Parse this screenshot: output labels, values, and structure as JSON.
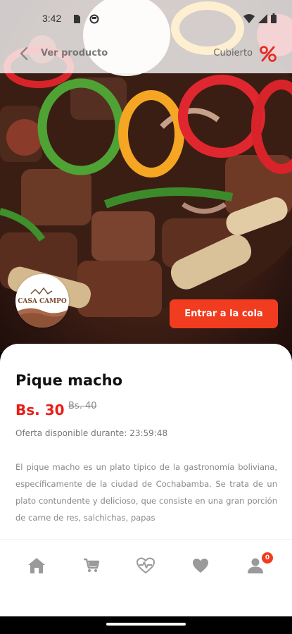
{
  "status_bar": {
    "time": "3:42",
    "icons": [
      "sim-icon",
      "circle-icon",
      "wifi-icon",
      "signal-icon",
      "battery-icon"
    ]
  },
  "app_bar": {
    "title": "Ver producto",
    "cover_label": "Cubierto",
    "back_icon": "chevron-left-icon",
    "discount_icon": "percent-icon"
  },
  "restaurant": {
    "logo_text": "CASA CAMPO"
  },
  "cta": {
    "label": "Entrar a la cola"
  },
  "product": {
    "name": "Pique macho",
    "price": "Bs. 30",
    "old_price": "Bs. 40",
    "offer_label": "Oferta disponible durante:",
    "offer_time": "23:59:48",
    "description": "El pique macho es un plato típico de la gastronomía boliviana, específicamente de la ciudad de Cochabamba. Se trata de un plato contundente y delicioso, que consiste en una gran porción de carne de res, salchichas, papas"
  },
  "bottom_nav": {
    "items": [
      {
        "icon": "home-icon"
      },
      {
        "icon": "cart-icon"
      },
      {
        "icon": "health-icon"
      },
      {
        "icon": "heart-icon"
      },
      {
        "icon": "user-icon"
      }
    ],
    "profile_badge": "0"
  },
  "colors": {
    "accent": "#f23c1f",
    "price": "#e81e16",
    "nav_icon": "#9a9a9a"
  }
}
